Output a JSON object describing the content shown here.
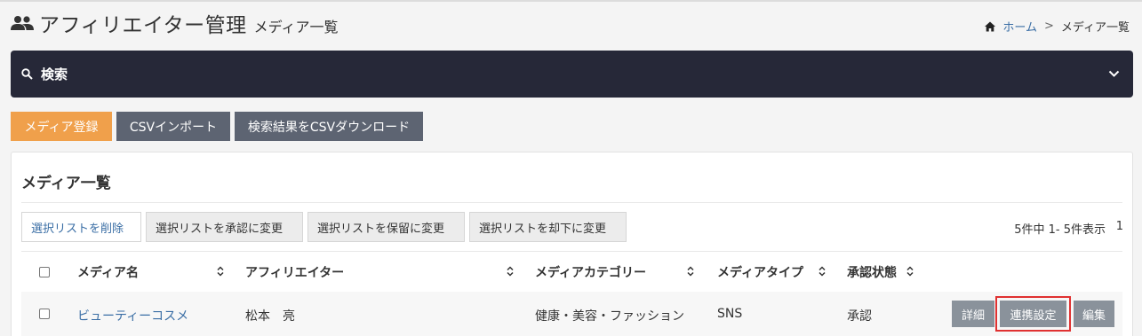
{
  "header": {
    "title": "アフィリエイター管理",
    "subtitle": "メディア一覧",
    "icon": "users-icon"
  },
  "breadcrumb": {
    "home_label": "ホーム",
    "separator": ">",
    "current": "メディア一覧"
  },
  "search": {
    "label": "検索",
    "expanded": false
  },
  "actions": {
    "register": "メディア登録",
    "csv_import": "CSVインポート",
    "csv_download": "検索結果をCSVダウンロード"
  },
  "panel": {
    "title": "メディア一覧",
    "bulk_actions": {
      "delete": "選択リストを削除",
      "approve": "選択リストを承認に変更",
      "hold": "選択リストを保留に変更",
      "reject": "選択リストを却下に変更"
    },
    "count_text": "5件中 1- 5件表示",
    "page": "1"
  },
  "table": {
    "columns": {
      "media_name": "メディア名",
      "affiliator": "アフィリエイター",
      "category": "メディアカテゴリー",
      "type": "メディアタイプ",
      "status": "承認状態"
    },
    "rows": [
      {
        "media_name": "ビューティーコスメ",
        "affiliator": "松本　亮",
        "category": "健康・美容・ファッション",
        "type": "SNS",
        "status": "承認",
        "detail_label": "詳細",
        "link_label": "連携設定",
        "edit_label": "編集"
      }
    ]
  },
  "colors": {
    "accent_orange": "#f0a04b",
    "search_bar_bg": "#262838",
    "link_blue": "#3a6ea5",
    "highlight_red": "#e03131"
  }
}
